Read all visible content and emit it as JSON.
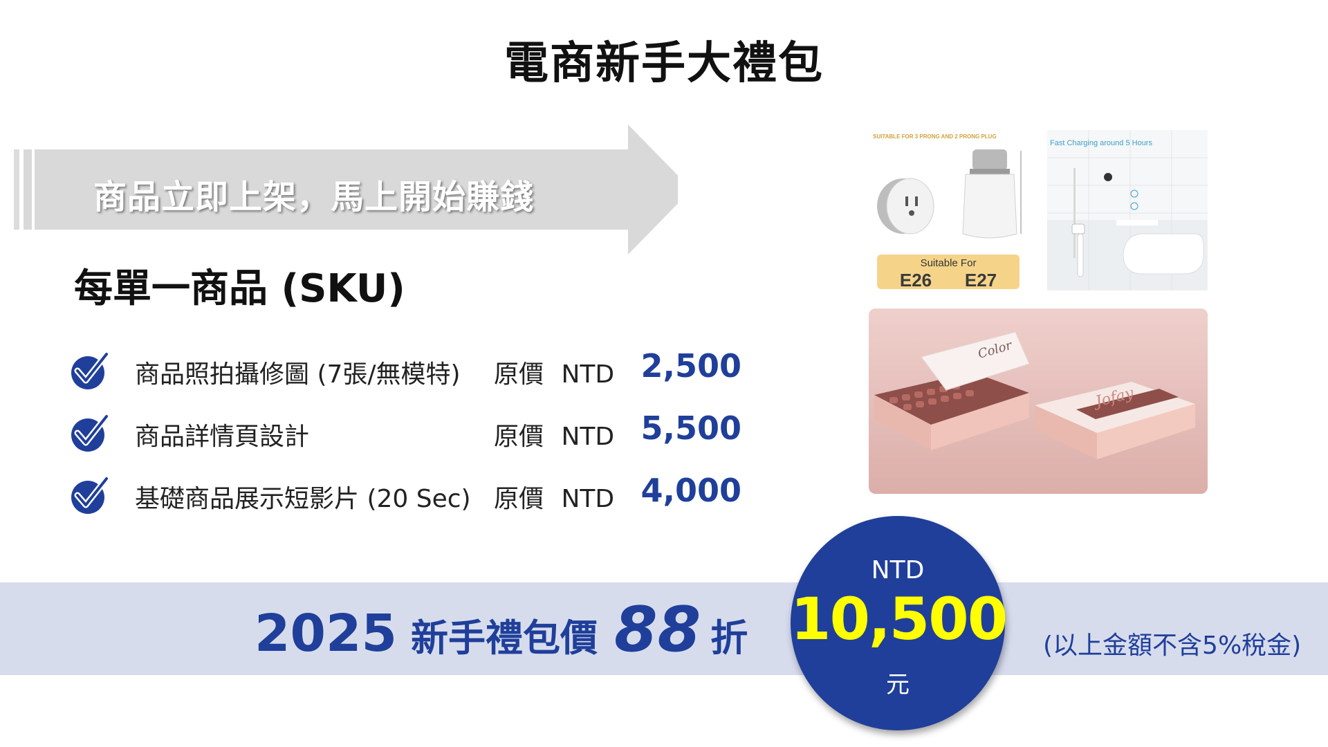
{
  "title": "電商新手大禮包",
  "banner_text": "商品立即上架，馬上開始賺錢",
  "sku_heading": "每單一商品 (SKU)",
  "items": [
    {
      "label": "商品照拍攝修圖 (7張/無模特)",
      "price_label": "原價 NTD",
      "price": "2,500"
    },
    {
      "label": "商品詳情頁設計",
      "price_label": "原價 NTD",
      "price": "5,500"
    },
    {
      "label": "基礎商品展示短影片 (20 Sec)",
      "price_label": "原價 NTD",
      "price": "4,000"
    }
  ],
  "images": {
    "plug": {
      "caption_top": "SUITABLE FOR 3 PRONG AND 2 PRONG PLUG",
      "suitable_for": "Suitable For",
      "e26": "E26",
      "e27": "E27"
    },
    "bath": {
      "caption_top": "Fast Charging around 5 Hours"
    },
    "box": {
      "brand_a": "Color",
      "brand_b": "Jofay"
    }
  },
  "promo": {
    "year": "2025",
    "text": "新手禮包價",
    "discount": "88",
    "discount_unit": "折",
    "currency": "NTD",
    "amount": "10,500",
    "unit": "元",
    "tax_note": "(以上金額不含5%稅金)"
  },
  "colors": {
    "accent": "#1f3f9a",
    "highlight": "#ffff00",
    "band": "#d7dced",
    "arrow": "#d9d9d9"
  }
}
